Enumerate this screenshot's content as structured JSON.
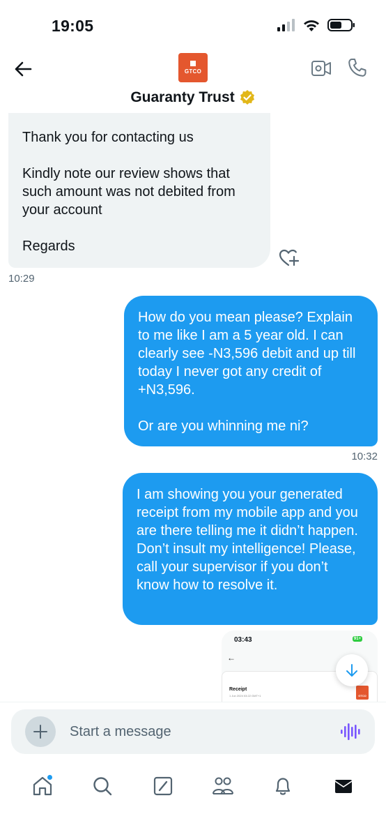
{
  "status_bar": {
    "time": "19:05",
    "icons": [
      "cellular-icon",
      "wifi-icon",
      "battery-icon"
    ]
  },
  "header": {
    "title": "Guaranty Trust",
    "avatar_text": "GTCO",
    "verified": true,
    "accent": "#e4572e"
  },
  "messages": {
    "incoming": {
      "lines": [
        "Thank you for contacting us",
        "Kindly note our review shows that such amount was not debited from your account",
        "Regards"
      ],
      "time": "10:29"
    },
    "outgoing_1": {
      "lines": [
        "How do you mean please? Explain to me like I am a 5 year old. I can clearly see -N3,596 debit and up till today I never got any credit of +N3,596.",
        "Or are you whinning me ni?"
      ],
      "time": "10:32"
    },
    "outgoing_2": {
      "text": "I am showing you your generated receipt from my mobile app and you are there telling me it didn’t happen. Don’t insult my intelligence! Please, call your supervisor if you don’t know how to resolve it."
    },
    "image_preview": {
      "status_time": "03:43",
      "battery": "91+",
      "title": "Receipt",
      "date": "1 Jun 2024 03:22 GMT+1",
      "logo_text": "GTCO"
    }
  },
  "composer": {
    "placeholder": "Start a message",
    "value": ""
  },
  "bottom_nav": [
    "home-icon",
    "search-icon",
    "grok-icon",
    "communities-icon",
    "notifications-icon",
    "messages-icon"
  ],
  "colors": {
    "blue": "#1d9bf0",
    "bubble_gray": "#eff3f4",
    "voice_purple": "#7856ff"
  }
}
